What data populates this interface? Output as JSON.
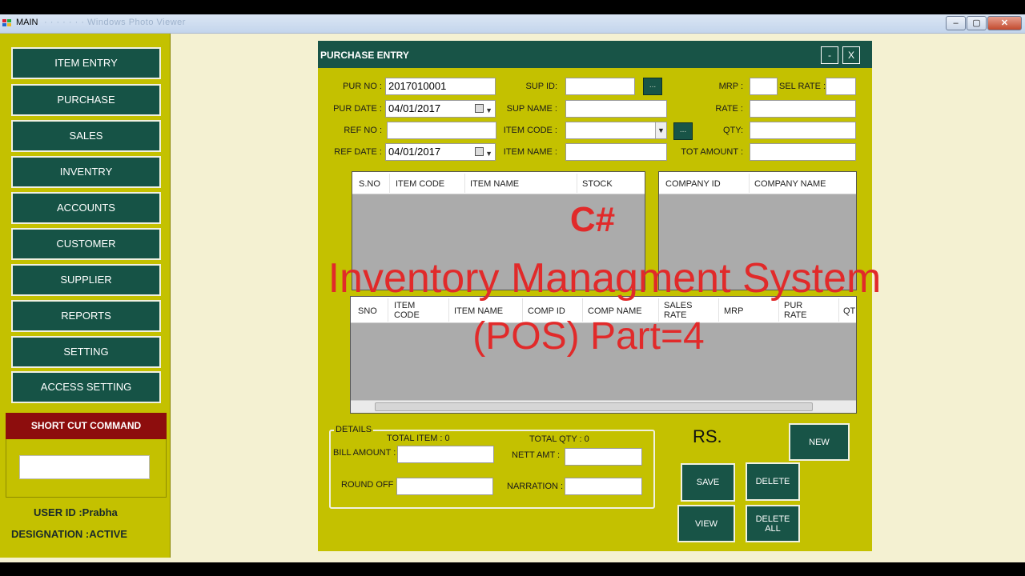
{
  "window": {
    "title": "MAIN",
    "title_blurred": "· · · · · · ·  Windows Photo Viewer",
    "caption_buttons": [
      "–",
      "▢",
      "✕"
    ]
  },
  "sidebar": {
    "items": [
      {
        "label": "ITEM ENTRY"
      },
      {
        "label": "PURCHASE"
      },
      {
        "label": "SALES"
      },
      {
        "label": "INVENTRY"
      },
      {
        "label": "ACCOUNTS"
      },
      {
        "label": "CUSTOMER"
      },
      {
        "label": "SUPPLIER"
      },
      {
        "label": "REPORTS"
      },
      {
        "label": "SETTING"
      },
      {
        "label": "ACCESS SETTING"
      }
    ],
    "shortcut_title": "SHORT CUT  COMMAND",
    "shortcut_value": "",
    "user_id": "USER ID :Prabha",
    "designation": "DESIGNATION :ACTIVE"
  },
  "form": {
    "title": "PURCHASE ENTRY",
    "minimize_label": "-",
    "close_label": "X",
    "fields": {
      "pur_no_label": "PUR NO :",
      "pur_no": "2017010001",
      "pur_date_label": "PUR DATE :",
      "pur_date": "04/01/2017",
      "ref_no_label": "REF NO :",
      "ref_no": "",
      "ref_date_label": "REF DATE :",
      "ref_date": "04/01/2017",
      "sup_id_label": "SUP ID:",
      "sup_id": "",
      "sup_name_label": "SUP NAME :",
      "sup_name": "",
      "item_code_label": "ITEM CODE :",
      "item_code": "",
      "item_name_label": "ITEM NAME :",
      "item_name": "",
      "mrp_label": "MRP :",
      "mrp": "",
      "sel_rate_label": "SEL RATE :",
      "sel_rate": "",
      "rate_label": "RATE :",
      "rate": "",
      "qty_label": "QTY:",
      "qty": "",
      "tot_amount_label": "TOT AMOUNT :",
      "tot_amount": "",
      "browse_label": "..."
    },
    "item_grid": {
      "columns": [
        "S.NO",
        "ITEM CODE",
        "ITEM NAME",
        "STOCK"
      ]
    },
    "company_grid": {
      "columns": [
        "COMPANY ID",
        "COMPANY NAME"
      ]
    },
    "entry_grid": {
      "columns": [
        "SNO",
        "ITEM\nCODE",
        "ITEM NAME",
        "COMP ID",
        "COMP NAME",
        "SALES\nRATE",
        "MRP",
        "PUR\nRATE",
        "QT"
      ]
    },
    "details": {
      "legend": "DETAILS",
      "total_item": "TOTAL ITEM :   0",
      "total_qty": "TOTAL QTY :    0",
      "bill_amount_label": "BILL AMOUNT :",
      "bill_amount": "",
      "nett_amt_label": "NETT AMT  :",
      "nett_amt": "",
      "round_off_label": "ROUND OFF :",
      "round_off": "",
      "narration_label": "NARRATION :",
      "narration": ""
    },
    "rs_label": "RS.",
    "buttons": {
      "new": "NEW",
      "save": "SAVE",
      "delete": "DELETE",
      "view": "VIEW",
      "delete_all": "DELETE\nALL"
    }
  },
  "overlay": {
    "line1": "C#",
    "line2": "Inventory Managment System",
    "line3": "(POS) Part=4",
    "color": "#e12a2a"
  }
}
